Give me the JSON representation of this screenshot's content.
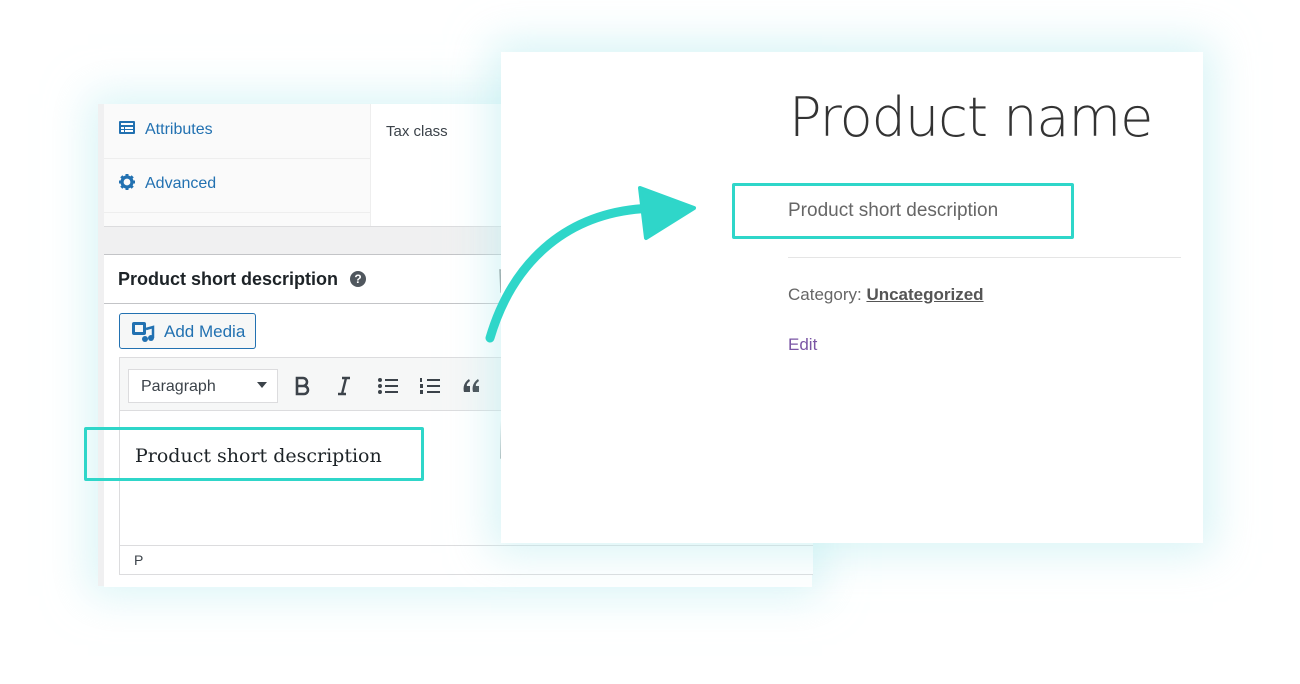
{
  "admin": {
    "tabs": [
      {
        "label": "Attributes",
        "icon": "attributes-icon"
      },
      {
        "label": "Advanced",
        "icon": "gear-icon"
      }
    ],
    "tax_class_label": "Tax class",
    "short_description_panel": {
      "title": "Product short description",
      "help_icon_glyph": "?",
      "add_media_label": "Add Media",
      "format_select_value": "Paragraph",
      "toolbar_buttons": [
        "bold-icon",
        "italic-icon",
        "bulleted-list-icon",
        "numbered-list-icon",
        "blockquote-icon"
      ],
      "editor_content": "Product short description",
      "status_path": "P"
    }
  },
  "frontend": {
    "product_name": "Product name",
    "short_description": "Product short description",
    "category_label": "Category:",
    "category_value": "Uncategorized",
    "edit_label": "Edit"
  },
  "colors": {
    "highlight": "#2fd6c9",
    "admin_link": "#2271b1",
    "edit_link": "#7a55a4"
  }
}
